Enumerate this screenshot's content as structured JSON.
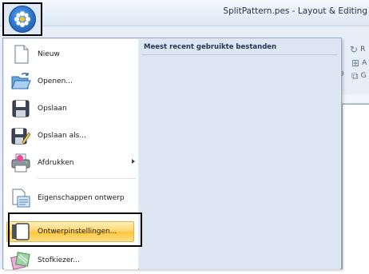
{
  "window": {
    "title": "SplitPattern.pes - Layout & Editing"
  },
  "ribbon": {
    "button_a": "R",
    "button_b": "A",
    "button_c": "G",
    "button_d": "9"
  },
  "app_menu": {
    "items": [
      {
        "label": "Nieuw",
        "icon": "new-document-icon",
        "has_submenu": false
      },
      {
        "label": "Openen...",
        "icon": "open-folder-icon",
        "has_submenu": false
      },
      {
        "label": "Opslaan",
        "icon": "save-disk-icon",
        "has_submenu": false
      },
      {
        "label": "Opslaan als...",
        "icon": "save-as-icon",
        "has_submenu": false
      },
      {
        "label": "Afdrukken",
        "icon": "printer-icon",
        "has_submenu": true
      },
      {
        "label": "Eigenschappen ontwerp",
        "icon": "design-properties-icon",
        "has_submenu": false
      },
      {
        "label": "Ontwerpinstellingen...",
        "icon": "design-settings-icon",
        "has_submenu": false,
        "highlighted": true
      },
      {
        "label": "Stofkiezer...",
        "icon": "fabric-selector-icon",
        "has_submenu": false
      }
    ],
    "recent_title": "Meest recent gebruikte bestanden"
  },
  "colors": {
    "highlight": "#ffd46a",
    "menu_background": "#e4ecf6",
    "app_orb": "#2c72c9"
  }
}
